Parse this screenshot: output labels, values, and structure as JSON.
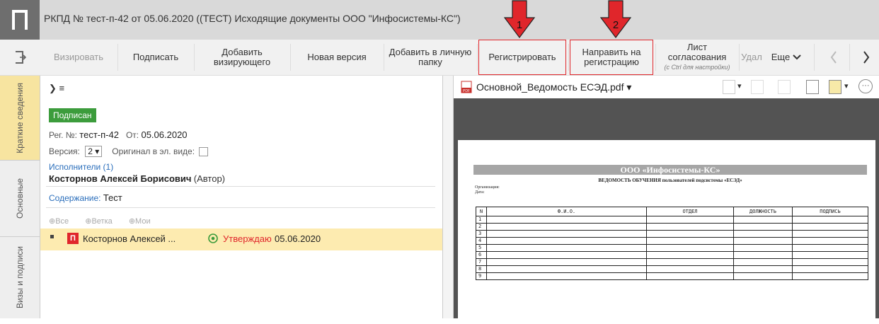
{
  "window": {
    "title": "РКПД № тест-п-42 от 05.06.2020 ((ТЕСТ) Исходящие документы ООО \"Инфосистемы-КС\")"
  },
  "toolbar": {
    "buttons": [
      {
        "label": "Визировать",
        "enabled": false
      },
      {
        "label": "Подписать",
        "enabled": true
      },
      {
        "label": "Добавить визирующего",
        "enabled": true
      },
      {
        "label": "Новая версия",
        "enabled": true
      },
      {
        "label": "Добавить в личную папку",
        "enabled": true
      },
      {
        "label": "Регистрировать",
        "enabled": true,
        "marker": "1"
      },
      {
        "label": "Направить на регистрацию",
        "enabled": true,
        "marker": "2"
      },
      {
        "label": "Лист согласования",
        "sub": "(с Ctrl для настройки)",
        "enabled": true
      },
      {
        "label": "Удал",
        "enabled": false
      },
      {
        "label": "Еще",
        "enabled": true
      }
    ],
    "annotation_color": "#e0262b"
  },
  "sidebar": {
    "tabs": [
      "Краткие сведения",
      "Основные",
      "Визы и подписи"
    ],
    "active": 0
  },
  "summary": {
    "status": "Подписан",
    "reg_label": "Рег. №:",
    "reg_value": "тест-п-42",
    "date_label": "От:",
    "date_value": "05.06.2020",
    "version_label": "Версия:",
    "version_value": "2",
    "original_label": "Оригинал в эл. виде:",
    "executors_link": "Исполнители (1)",
    "executor_name": "Косторнов Алексей Борисович",
    "executor_role": "(Автор)",
    "content_label": "Содержание:",
    "content_value": "Тест",
    "filters": [
      "⊕Все",
      "⊕Ветка",
      "⊕Мои"
    ],
    "route_person": "Косторнов Алексей ...",
    "route_status": "Утверждаю",
    "route_date": "05.06.2020"
  },
  "document": {
    "filename": "Основной_Ведомость ЕСЭД.pdf",
    "org_header": "ООО «Инфосистемы-КС»",
    "sheet_title": "ВЕДОМОСТЬ ОБУЧЕНИЯ пользователей подсистемы «ЕСЭД»",
    "org_label": "Организация:",
    "date_label": "Дата:",
    "table_headers": [
      "N",
      "Ф.И.О.",
      "ОТДЕЛ",
      "ДОЛЖНОСТЬ",
      "ПОДПИСЬ"
    ],
    "row_numbers": [
      "1",
      "2",
      "3",
      "4",
      "5",
      "6",
      "7",
      "8",
      "9"
    ]
  }
}
